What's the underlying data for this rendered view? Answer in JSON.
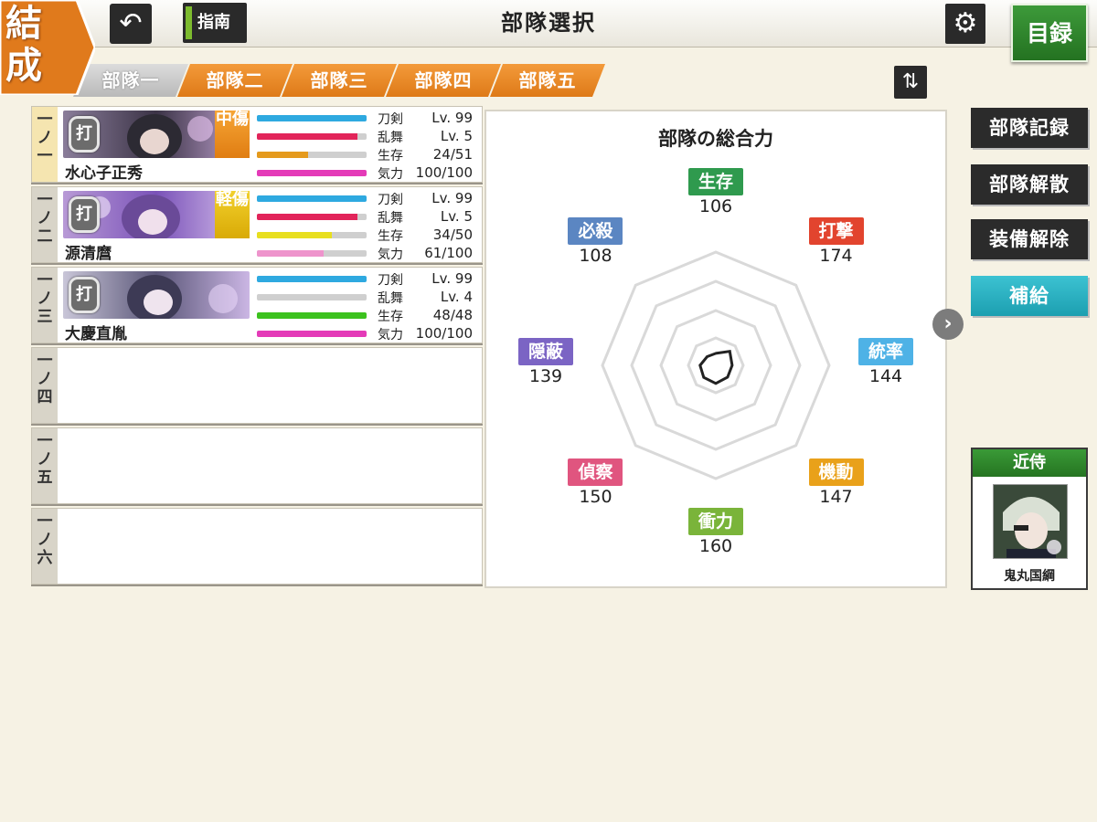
{
  "header": {
    "badge_top": "結",
    "badge_bottom": "成",
    "back_icon": "undo-arrow-icon",
    "guide_label": "指南",
    "title": "部隊選択",
    "settings_icon": "gear-icon",
    "catalog_label": "目録"
  },
  "tabs": [
    {
      "label": "部隊一",
      "active": true
    },
    {
      "label": "部隊二",
      "active": false
    },
    {
      "label": "部隊三",
      "active": false
    },
    {
      "label": "部隊四",
      "active": false
    },
    {
      "label": "部隊五",
      "active": false
    }
  ],
  "swap_icon": "swap-arrows-icon",
  "members": [
    {
      "slot": "一ノ一",
      "name": "水心子正秀",
      "type": "打",
      "damage": "中傷",
      "stats": [
        {
          "label": "刀剣",
          "value": "Lv.  99",
          "fill": 1.0,
          "color": "#2ea9e0"
        },
        {
          "label": "乱舞",
          "value": "Lv.   5",
          "fill": 0.92,
          "color": "#e2245a"
        },
        {
          "label": "生存",
          "value": "24/51",
          "fill": 0.47,
          "color": "#e59a1c"
        },
        {
          "label": "気力",
          "value": "100/100",
          "fill": 1.0,
          "color": "#e43bb8"
        }
      ]
    },
    {
      "slot": "一ノ二",
      "name": "源清麿",
      "type": "打",
      "damage": "軽傷",
      "stats": [
        {
          "label": "刀剣",
          "value": "Lv.  99",
          "fill": 1.0,
          "color": "#2ea9e0"
        },
        {
          "label": "乱舞",
          "value": "Lv.   5",
          "fill": 0.92,
          "color": "#e2245a"
        },
        {
          "label": "生存",
          "value": "34/50",
          "fill": 0.68,
          "color": "#e8df1e"
        },
        {
          "label": "気力",
          "value": "61/100",
          "fill": 0.61,
          "color": "#ee94cc"
        }
      ]
    },
    {
      "slot": "一ノ三",
      "name": "大慶直胤",
      "type": "打",
      "damage": "",
      "stats": [
        {
          "label": "刀剣",
          "value": "Lv.  99",
          "fill": 1.0,
          "color": "#2ea9e0"
        },
        {
          "label": "乱舞",
          "value": "Lv.   4",
          "fill": 0.0,
          "color": "#e2245a"
        },
        {
          "label": "生存",
          "value": "48/48",
          "fill": 1.0,
          "color": "#3cc21e"
        },
        {
          "label": "気力",
          "value": "100/100",
          "fill": 1.0,
          "color": "#e43bb8"
        }
      ]
    },
    {
      "slot": "一ノ四"
    },
    {
      "slot": "一ノ五"
    },
    {
      "slot": "一ノ六"
    }
  ],
  "radar": {
    "title": "部隊の総合力",
    "stats": [
      {
        "label": "生存",
        "value": "106",
        "color": "#2f9a4e"
      },
      {
        "label": "打撃",
        "value": "174",
        "color": "#e2442e"
      },
      {
        "label": "統率",
        "value": "144",
        "color": "#4eb2e6"
      },
      {
        "label": "機動",
        "value": "147",
        "color": "#e9a11a"
      },
      {
        "label": "衝力",
        "value": "160",
        "color": "#7ab43a"
      },
      {
        "label": "偵察",
        "value": "150",
        "color": "#e0557f"
      },
      {
        "label": "隠蔽",
        "value": "139",
        "color": "#7b64c4"
      },
      {
        "label": "必殺",
        "value": "108",
        "color": "#5b86c2"
      }
    ]
  },
  "side_buttons": [
    {
      "label": "部隊記録"
    },
    {
      "label": "部隊解散"
    },
    {
      "label": "装備解除"
    },
    {
      "label": "補給"
    }
  ],
  "next_icon": "chevron-right-icon",
  "attendant": {
    "header": "近侍",
    "name": "鬼丸国綱"
  }
}
